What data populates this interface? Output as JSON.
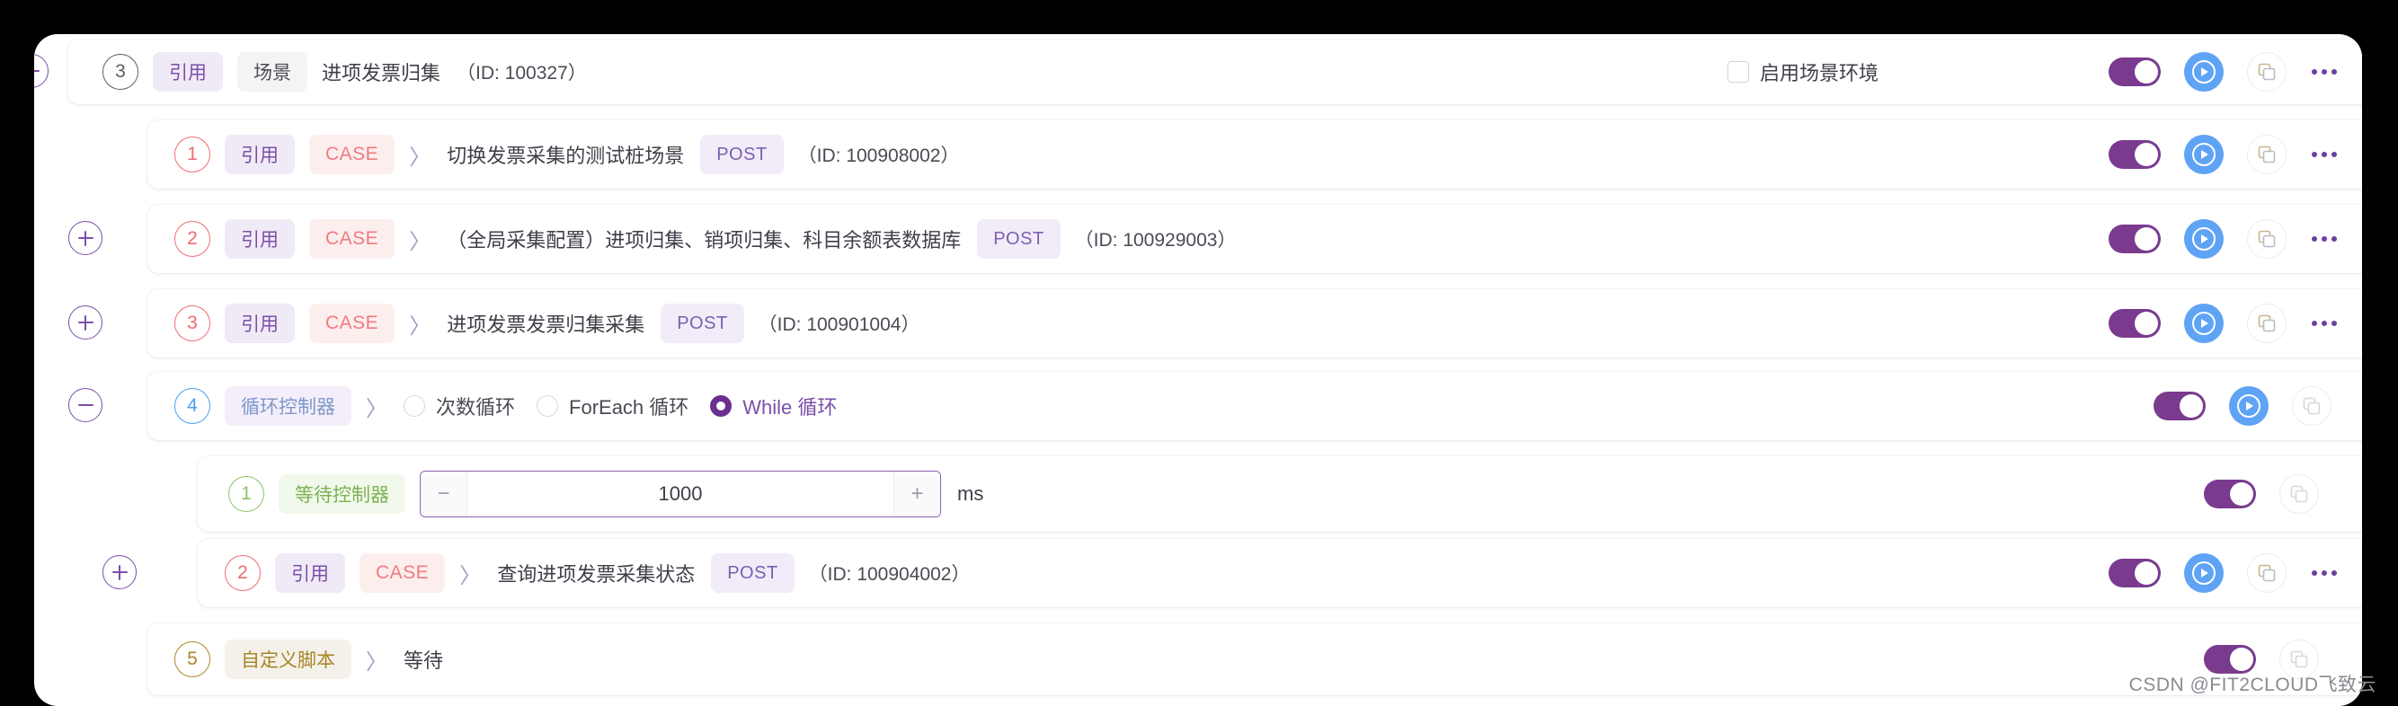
{
  "watermark": "CSDN @FIT2CLOUD飞致云",
  "colors": {
    "accent_purple": "#7b4fa8",
    "toggle_on": "#7a3b8f",
    "run_blue": "#5fa3f5",
    "case_red": "#f07b7f",
    "wait_green": "#7db352",
    "script_gold": "#a98528",
    "loop_blue": "#4c9ef0"
  },
  "icons": {
    "collapse": "minus-icon",
    "expand": "plus-icon",
    "chevron": "chevron-right-icon",
    "run": "run-play-icon",
    "copy": "copy-icon",
    "more": "more-dots-icon",
    "toggle": "toggle-switch-on-icon",
    "checkbox": "checkbox-unchecked-icon"
  },
  "scenario_header": {
    "handle": "−",
    "index": "3",
    "quote_tag": "引用",
    "type_tag": "场景",
    "title": "进项发票归集",
    "id_text": "（ID: 100327）",
    "env_checkbox_label": "启用场景环境",
    "env_checked": false,
    "toggle_on": true
  },
  "steps": [
    {
      "handle": "",
      "index": "1",
      "index_color": "red",
      "quote_tag": "引用",
      "type_tag": "CASE",
      "type_class": "case",
      "chevron": "〉",
      "title": "切换发票采集的测试桩场景",
      "method_tag": "POST",
      "id_text": "（ID: 100908002）",
      "toggle_on": true
    },
    {
      "handle": "+",
      "index": "2",
      "index_color": "red",
      "quote_tag": "引用",
      "type_tag": "CASE",
      "type_class": "case",
      "chevron": "〉",
      "title": "（全局采集配置）进项归集、销项归集、科目余额表数据库",
      "method_tag": "POST",
      "id_text": "（ID: 100929003）",
      "toggle_on": true
    },
    {
      "handle": "+",
      "index": "3",
      "index_color": "red",
      "quote_tag": "引用",
      "type_tag": "CASE",
      "type_class": "case",
      "chevron": "〉",
      "title": "进项发票发票归集采集",
      "method_tag": "POST",
      "id_text": "（ID: 100901004）",
      "toggle_on": true
    }
  ],
  "loop_controller": {
    "handle": "−",
    "index": "4",
    "type_tag": "循环控制器",
    "chevron": "〉",
    "options": [
      {
        "label": "次数循环",
        "selected": false
      },
      {
        "label": "ForEach 循环",
        "selected": false
      },
      {
        "label": "While 循环",
        "selected": true
      }
    ],
    "toggle_on": true
  },
  "wait_controller": {
    "index": "1",
    "type_tag": "等待控制器",
    "minus": "−",
    "plus": "+",
    "value": "1000",
    "unit": "ms",
    "toggle_on": true
  },
  "query_step": {
    "handle": "+",
    "index": "2",
    "quote_tag": "引用",
    "type_tag": "CASE",
    "chevron": "〉",
    "title": "查询进项发票采集状态",
    "method_tag": "POST",
    "id_text": "（ID: 100904002）",
    "toggle_on": true
  },
  "script_step": {
    "index": "5",
    "type_tag": "自定义脚本",
    "chevron": "〉",
    "title": "等待",
    "toggle_on": true
  }
}
